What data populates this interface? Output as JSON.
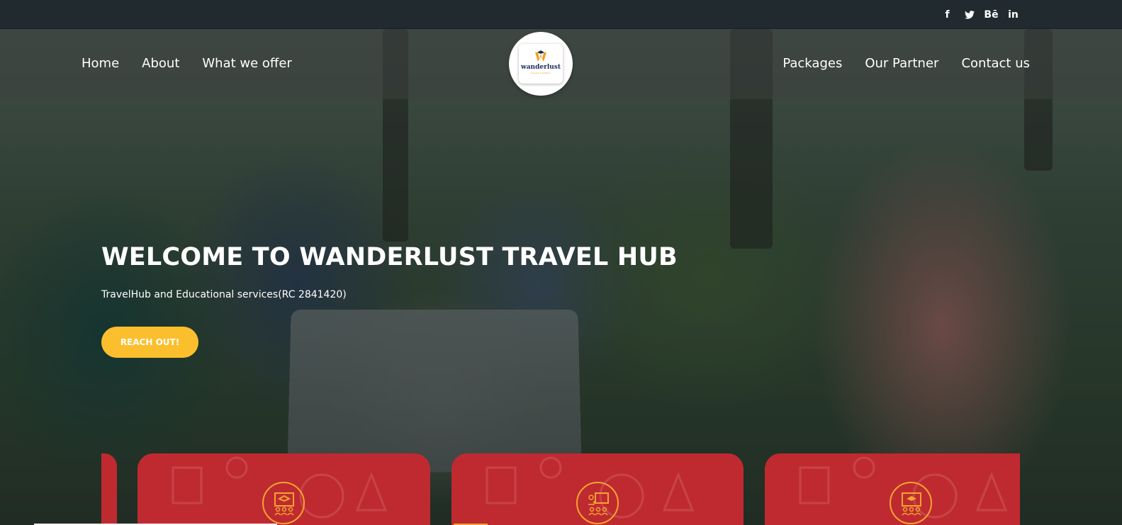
{
  "topbar": {
    "social": [
      {
        "name": "facebook-icon",
        "glyph": "f"
      },
      {
        "name": "twitter-icon",
        "glyph": "𝕥"
      },
      {
        "name": "behance-icon",
        "glyph": "Bē"
      },
      {
        "name": "linkedin-icon",
        "glyph": "in"
      }
    ]
  },
  "nav": {
    "left": [
      "Home",
      "About",
      "What we offer"
    ],
    "right": [
      "Packages",
      "Our Partner",
      "Contact us"
    ]
  },
  "logo": {
    "text": "wanderlust",
    "sub": "travel & education"
  },
  "hero": {
    "title": "WELCOME TO WANDERLUST TRAVEL HUB",
    "subtitle": "TravelHub and Educational services(RC 2841420)",
    "cta_label": "REACH OUT!"
  },
  "cards": [
    {
      "icon": "graduation-class-icon"
    },
    {
      "icon": "presentation-class-icon"
    },
    {
      "icon": "graduation-board-icon"
    }
  ],
  "colors": {
    "topbar": "#212a2e",
    "cta": "#fbbf2e",
    "card": "#bf2a30",
    "card_icon": "#f3a52f"
  }
}
